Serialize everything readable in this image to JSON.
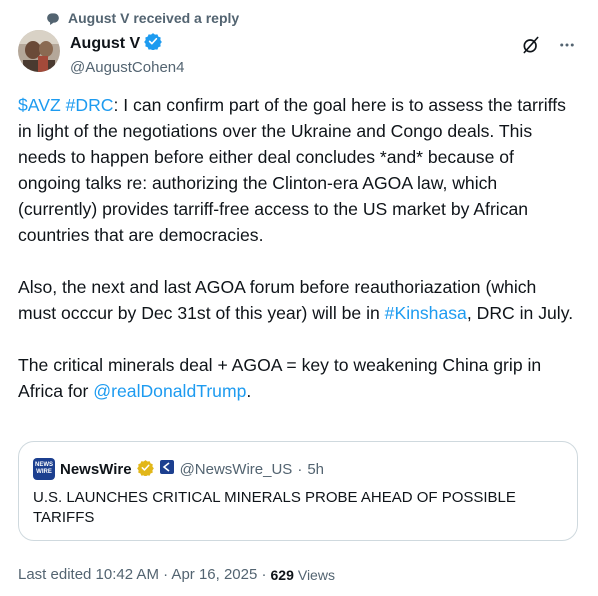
{
  "social_context": {
    "text": "August V received a reply"
  },
  "author": {
    "display_name": "August V",
    "handle": "@AugustCohen4",
    "verified": true
  },
  "post": {
    "p1": {
      "cashtag": "$AVZ",
      "hashtag": "#DRC",
      "text": ": I can confirm part of the goal here is to assess the tarriffs in light of the negotiations over the Ukraine and Congo deals. This needs to happen before either deal concludes *and* because of ongoing talks re: authorizing the Clinton-era AGOA law, which (currently) provides tarriff-free access to the US market by African countries that are democracies."
    },
    "p2": {
      "text_before": "Also, the next and last AGOA forum before reauthoriazation (which must occcur by Dec 31st of this year) will be in ",
      "hashtag": "#Kinshasa",
      "text_after": ", DRC in July."
    },
    "p3": {
      "text_before": "The critical minerals deal + AGOA = key to weakening China grip in Africa for ",
      "mention": "@realDonaldTrump",
      "text_after": "."
    }
  },
  "quote": {
    "avatar_line1": "NEWS",
    "avatar_line2": "WIRE",
    "display_name": "NewsWire",
    "handle": "@NewsWire_US",
    "separator": "·",
    "time": "5h",
    "text": "U.S. LAUNCHES CRITICAL MINERALS PROBE AHEAD OF POSSIBLE TARIFFS"
  },
  "footer": {
    "edited": "Last edited 10:42 AM · Apr 16, 2025 ·",
    "views_count": "629",
    "views_label": "Views"
  },
  "colors": {
    "link": "#1d9bf0",
    "verified_blue": "#1d9bf0",
    "verified_gold": "#e2b719",
    "secondary_text": "#536471",
    "border": "#cfd9de"
  },
  "icons": {
    "social": "reply-icon",
    "verified": "verified-badge-icon",
    "grok": "grok-icon",
    "more": "more-icon",
    "affiliate": "affiliate-badge-icon"
  }
}
